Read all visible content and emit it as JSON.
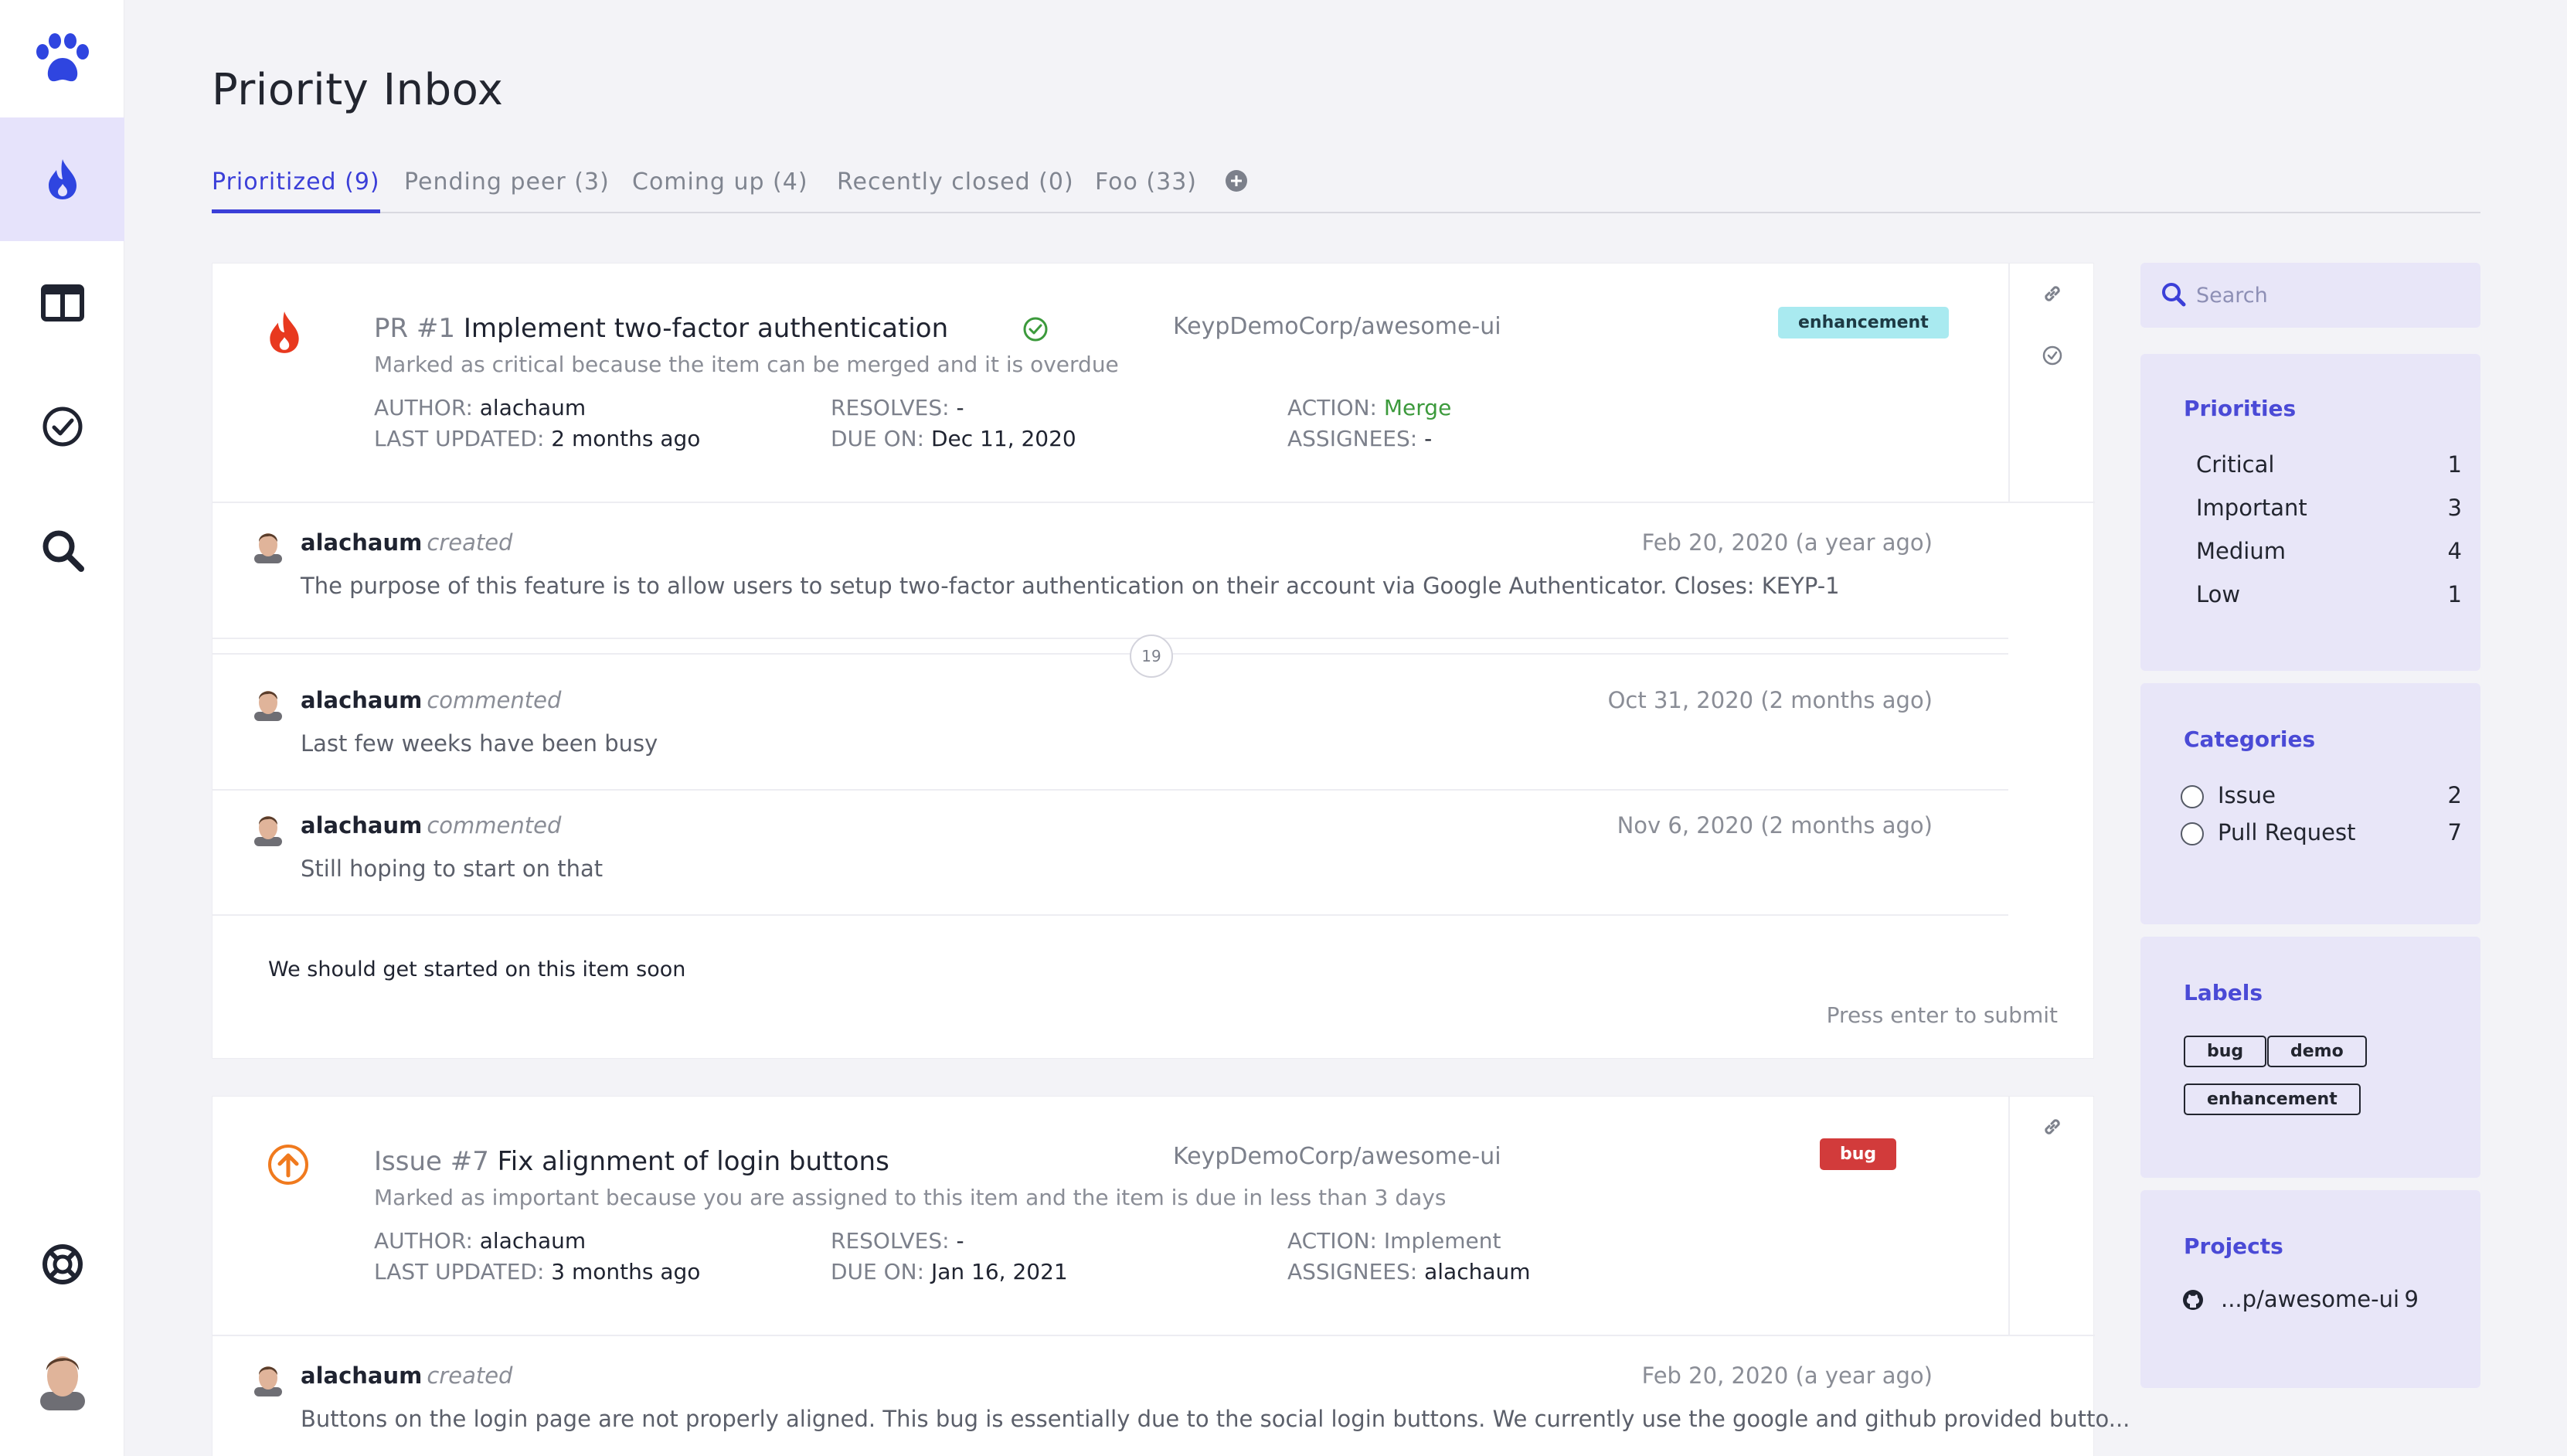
{
  "page": {
    "title": "Priority Inbox"
  },
  "sidebar": {
    "items": [
      {
        "name": "logo",
        "icon": "paw-icon"
      },
      {
        "name": "priority",
        "icon": "flame-icon",
        "active": true
      },
      {
        "name": "board",
        "icon": "columns-icon"
      },
      {
        "name": "done",
        "icon": "check-circle-icon"
      },
      {
        "name": "search",
        "icon": "search-icon"
      },
      {
        "name": "help",
        "icon": "lifebuoy-icon"
      },
      {
        "name": "profile",
        "icon": "avatar"
      }
    ]
  },
  "tabs": [
    {
      "label": "Prioritized (9)",
      "active": true
    },
    {
      "label": "Pending peer (3)"
    },
    {
      "label": "Coming up (4)"
    },
    {
      "label": "Recently closed (0)"
    },
    {
      "label": "Foo (33)"
    }
  ],
  "items": [
    {
      "priority_color": "#e8391f",
      "kind": "PR #1",
      "title": "Implement two-factor authentication",
      "reason": "Marked as critical because the item can be merged and it is overdue",
      "repo": "KeypDemoCorp/awesome-ui",
      "label": "enhancement",
      "meta": {
        "author_k": "AUTHOR:",
        "author_v": " alachaum",
        "updated_k": "LAST UPDATED:",
        "updated_v": " 2 months ago",
        "resolves_k": "RESOLVES:",
        "resolves_v": " -",
        "due_k": "DUE ON:",
        "due_v": " Dec 11, 2020",
        "action_k": "ACTION:",
        "action_v": " Merge",
        "assignees_k": "ASSIGNEES:",
        "assignees_v": " -"
      },
      "events": [
        {
          "user": "alachaum",
          "verb": "created",
          "date": "Feb 20, 2020 (a year ago)",
          "text": "The purpose of this feature is to allow users to setup two-factor authentication on their account via Google Authenticator. Closes: KEYP-1"
        },
        {
          "user": "alachaum",
          "verb": "commented",
          "date": "Oct 31, 2020 (2 months ago)",
          "text": "Last few weeks have been busy"
        },
        {
          "user": "alachaum",
          "verb": "commented",
          "date": "Nov 6, 2020 (2 months ago)",
          "text": "Still hoping to start on that"
        }
      ],
      "hidden_count": "19",
      "reply": {
        "value": "We should get started on this item soon",
        "hint": "Press enter to submit"
      }
    },
    {
      "priority_color": "#f07a1e",
      "kind": "Issue #7",
      "title": "Fix alignment of login buttons",
      "reason": "Marked as important because you are assigned to this item and the item is due in less than 3 days",
      "repo": "KeypDemoCorp/awesome-ui",
      "label": "bug",
      "meta": {
        "author_k": "AUTHOR:",
        "author_v": " alachaum",
        "updated_k": "LAST UPDATED:",
        "updated_v": " 3 months ago",
        "resolves_k": "RESOLVES:",
        "resolves_v": " -",
        "due_k": "DUE ON:",
        "due_v": " Jan 16, 2021",
        "action_k": "ACTION:",
        "action_v": " Implement",
        "assignees_k": "ASSIGNEES:",
        "assignees_v": " alachaum"
      },
      "events": [
        {
          "user": "alachaum",
          "verb": "created",
          "date": "Feb 20, 2020 (a year ago)",
          "text": "Buttons on the login page are not properly aligned. This bug is essentially due to the social login buttons. We currently use the google and github provided butto..."
        }
      ]
    }
  ],
  "search": {
    "placeholder": "Search"
  },
  "filters": {
    "priorities": {
      "title": "Priorities",
      "rows": [
        {
          "label": "Critical",
          "count": "1"
        },
        {
          "label": "Important",
          "count": "3"
        },
        {
          "label": "Medium",
          "count": "4"
        },
        {
          "label": "Low",
          "count": "1"
        }
      ]
    },
    "categories": {
      "title": "Categories",
      "rows": [
        {
          "label": "Issue",
          "count": "2"
        },
        {
          "label": "Pull Request",
          "count": "7"
        }
      ]
    },
    "labels": {
      "title": "Labels",
      "chips": [
        "bug",
        "demo",
        "enhancement"
      ]
    },
    "projects": {
      "title": "Projects",
      "rows": [
        {
          "label": "...p/awesome-ui",
          "count": "9",
          "icon": "github-icon"
        }
      ]
    }
  },
  "colors": {
    "accent": "#3b3fd8",
    "panel_bg": "#e8e6f8",
    "active_nav": "#e6e3fb"
  }
}
